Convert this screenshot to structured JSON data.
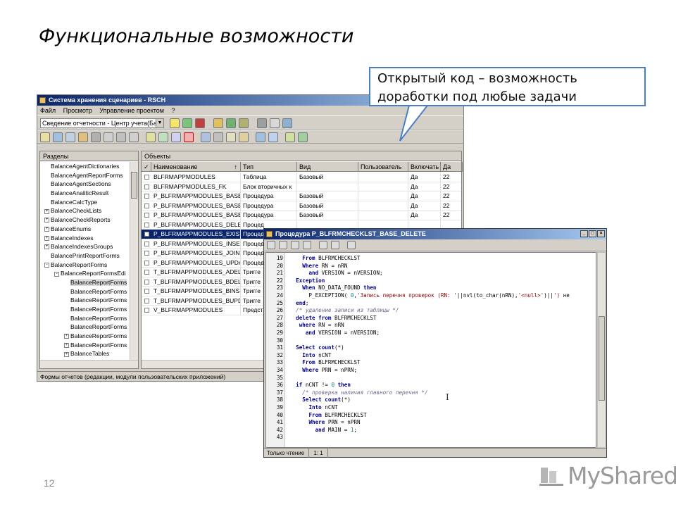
{
  "slide": {
    "title": "Функциональные возможности",
    "page_number": "12",
    "logo_text": "MyShared"
  },
  "callout": {
    "line1": "Открытый код – возможность",
    "line2": "доработки под любые задачи"
  },
  "main_window": {
    "title": "Система хранения сценариев - RSCH",
    "menu": [
      "Файл",
      "Просмотр",
      "Управление проектом",
      "?"
    ],
    "combo_value": "Сведение отчетности - Центр учета(Ба",
    "left_pane_title": "Разделы",
    "right_pane_title": "Объекты",
    "tree": [
      {
        "label": "BalanceAgentDictionaries",
        "indent": 0,
        "toggle": ""
      },
      {
        "label": "BalanceAgentReportForms",
        "indent": 0,
        "toggle": ""
      },
      {
        "label": "BalanceAgentSections",
        "indent": 0,
        "toggle": ""
      },
      {
        "label": "BalanceAnaliticResult",
        "indent": 0,
        "toggle": ""
      },
      {
        "label": "BalanceCalcType",
        "indent": 0,
        "toggle": ""
      },
      {
        "label": "BalanceCheckLists",
        "indent": 0,
        "toggle": "+"
      },
      {
        "label": "BalanceCheckReports",
        "indent": 0,
        "toggle": "+"
      },
      {
        "label": "BalanceEnums",
        "indent": 0,
        "toggle": "+"
      },
      {
        "label": "BalanceIndexes",
        "indent": 0,
        "toggle": "+"
      },
      {
        "label": "BalanceIndexesGroups",
        "indent": 0,
        "toggle": "+"
      },
      {
        "label": "BalancePrintReportForms",
        "indent": 0,
        "toggle": ""
      },
      {
        "label": "BalanceReportForms",
        "indent": 0,
        "toggle": "-"
      },
      {
        "label": "BalanceReportFormsEdi",
        "indent": 1,
        "toggle": "-"
      },
      {
        "label": "BalanceReportForms",
        "indent": 2,
        "toggle": "",
        "selected": true
      },
      {
        "label": "BalanceReportForms",
        "indent": 2,
        "toggle": ""
      },
      {
        "label": "BalanceReportForms",
        "indent": 2,
        "toggle": ""
      },
      {
        "label": "BalanceReportForms",
        "indent": 2,
        "toggle": ""
      },
      {
        "label": "BalanceReportForms",
        "indent": 2,
        "toggle": ""
      },
      {
        "label": "BalanceReportForms",
        "indent": 2,
        "toggle": ""
      },
      {
        "label": "BalanceReportForms",
        "indent": 2,
        "toggle": "+"
      },
      {
        "label": "BalanceReportForms",
        "indent": 2,
        "toggle": "+"
      },
      {
        "label": "BalanceTables",
        "indent": 2,
        "toggle": "+"
      },
      {
        "label": "BalanceReportViewPeriods",
        "indent": 0,
        "toggle": "+"
      }
    ],
    "columns": [
      "Наименование",
      "Тип",
      "Вид",
      "Пользователь",
      "Включать",
      "Да"
    ],
    "rows": [
      {
        "name": "BLFRMAPPMODULES",
        "type": "Таблица",
        "kind": "Базовый",
        "user": "",
        "incl": "Да",
        "date": "22"
      },
      {
        "name": "BLFRMAPPMODULES_FK",
        "type": "Блок вторичных к",
        "kind": "",
        "user": "",
        "incl": "Да",
        "date": "22"
      },
      {
        "name": "P_BLFRMAPPMODULES_BASE_DI",
        "type": "Процедура",
        "kind": "Базовый",
        "user": "",
        "incl": "Да",
        "date": "22"
      },
      {
        "name": "P_BLFRMAPPMODULES_BASE_IN",
        "type": "Процедура",
        "kind": "Базовый",
        "user": "",
        "incl": "Да",
        "date": "22"
      },
      {
        "name": "P_BLFRMAPPMODULES_BASE_UI",
        "type": "Процедура",
        "kind": "Базовый",
        "user": "",
        "incl": "Да",
        "date": "22"
      },
      {
        "name": "P_BLFRMAPPMODULES_DELETE",
        "type": "Процед",
        "kind": "",
        "user": "",
        "incl": "",
        "date": ""
      },
      {
        "name": "P_BLFRMAPPMODULES_EXISTS",
        "type": "Процед",
        "kind": "",
        "user": "",
        "incl": "",
        "date": "",
        "selected": true
      },
      {
        "name": "P_BLFRMAPPMODULES_INSERT",
        "type": "Процед",
        "kind": "",
        "user": "",
        "incl": "",
        "date": ""
      },
      {
        "name": "P_BLFRMAPPMODULES_JOINS",
        "type": "Процед",
        "kind": "",
        "user": "",
        "incl": "",
        "date": ""
      },
      {
        "name": "P_BLFRMAPPMODULES_UPDATE",
        "type": "Процед",
        "kind": "",
        "user": "",
        "incl": "",
        "date": ""
      },
      {
        "name": "T_BLFRMAPPMODULES_ADELETE",
        "type": "Тригге",
        "kind": "",
        "user": "",
        "incl": "",
        "date": ""
      },
      {
        "name": "T_BLFRMAPPMODULES_BDELETE",
        "type": "Тригге",
        "kind": "",
        "user": "",
        "incl": "",
        "date": ""
      },
      {
        "name": "T_BLFRMAPPMODULES_BINSERT",
        "type": "Тригге",
        "kind": "",
        "user": "",
        "incl": "",
        "date": ""
      },
      {
        "name": "T_BLFRMAPPMODULES_BUPDAT",
        "type": "Тригге",
        "kind": "",
        "user": "",
        "incl": "",
        "date": ""
      },
      {
        "name": "V_BLFRMAPPMODULES",
        "type": "Предст",
        "kind": "",
        "user": "",
        "incl": "",
        "date": ""
      }
    ],
    "status": "Формы отчетов (редакции, модули пользовательских приложений)"
  },
  "editor_window": {
    "title": "Процедура P_BLFRMCHECKLST_BASE_DELETE",
    "lines": [
      {
        "n": "19",
        "t": [
          [
            "",
            "    "
          ],
          [
            "kw",
            "From"
          ],
          [
            "",
            " BLFRMCHECKLST"
          ]
        ]
      },
      {
        "n": "20",
        "t": [
          [
            "",
            "    "
          ],
          [
            "kw",
            "Where"
          ],
          [
            "",
            " RN = nRN"
          ]
        ]
      },
      {
        "n": "21",
        "t": [
          [
            "",
            "      "
          ],
          [
            "kw",
            "and"
          ],
          [
            "",
            " VERSION = nVERSION;"
          ]
        ]
      },
      {
        "n": "22",
        "t": [
          [
            "",
            "  "
          ],
          [
            "kw",
            "Exception"
          ]
        ]
      },
      {
        "n": "23",
        "t": [
          [
            "",
            "    "
          ],
          [
            "kw",
            "When"
          ],
          [
            "",
            " NO_DATA_FOUND "
          ],
          [
            "kw",
            "then"
          ]
        ]
      },
      {
        "n": "24",
        "t": [
          [
            "",
            "      P_EXCEPTION( "
          ],
          [
            "num",
            "0"
          ],
          [
            "",
            ","
          ],
          [
            "st",
            "'Запись перечня проверок (RN: '"
          ],
          [
            "",
            "||nvl(to_char(nRN),"
          ],
          [
            "st",
            "'<null>'"
          ],
          [
            "",
            ")||"
          ],
          [
            "st",
            "')"
          ],
          [
            "",
            " не"
          ]
        ]
      },
      {
        "n": "25",
        "t": [
          [
            "",
            "  "
          ],
          [
            "kw",
            "end"
          ],
          [
            "",
            ";"
          ]
        ]
      },
      {
        "n": "26",
        "t": [
          [
            "cm",
            "  /* удаление записи из таблицы */"
          ]
        ]
      },
      {
        "n": "27",
        "t": [
          [
            "",
            "  "
          ],
          [
            "kw",
            "delete from"
          ],
          [
            "",
            " BLFRMCHECKLST"
          ]
        ]
      },
      {
        "n": "28",
        "t": [
          [
            "",
            "   "
          ],
          [
            "kw",
            "where"
          ],
          [
            "",
            " RN = nRN"
          ]
        ]
      },
      {
        "n": "29",
        "t": [
          [
            "",
            "     "
          ],
          [
            "kw",
            "and"
          ],
          [
            "",
            " VERSION = nVERSION;"
          ]
        ]
      },
      {
        "n": "30",
        "t": [
          [
            "",
            ""
          ]
        ]
      },
      {
        "n": "31",
        "t": [
          [
            "",
            "  "
          ],
          [
            "kw",
            "Select count"
          ],
          [
            "",
            "(*)"
          ]
        ]
      },
      {
        "n": "32",
        "t": [
          [
            "",
            "    "
          ],
          [
            "kw",
            "Into"
          ],
          [
            "",
            " nCNT"
          ]
        ]
      },
      {
        "n": "33",
        "t": [
          [
            "",
            "    "
          ],
          [
            "kw",
            "From"
          ],
          [
            "",
            " BLFRMCHECKLST"
          ]
        ]
      },
      {
        "n": "34",
        "t": [
          [
            "",
            "    "
          ],
          [
            "kw",
            "Where"
          ],
          [
            "",
            " PRN = nPRN;"
          ]
        ]
      },
      {
        "n": "35",
        "t": [
          [
            "",
            ""
          ]
        ]
      },
      {
        "n": "36",
        "t": [
          [
            "",
            "  "
          ],
          [
            "kw",
            "if"
          ],
          [
            "",
            " nCNT != "
          ],
          [
            "num",
            "0"
          ],
          [
            "",
            " "
          ],
          [
            "kw",
            "then"
          ]
        ]
      },
      {
        "n": "37",
        "t": [
          [
            "cm",
            "    /* проверка наличия главного перечня */"
          ]
        ]
      },
      {
        "n": "38",
        "t": [
          [
            "",
            "    "
          ],
          [
            "kw",
            "Select count"
          ],
          [
            "",
            "(*)"
          ]
        ]
      },
      {
        "n": "39",
        "t": [
          [
            "",
            "      "
          ],
          [
            "kw",
            "Into"
          ],
          [
            "",
            " nCNT"
          ]
        ]
      },
      {
        "n": "40",
        "t": [
          [
            "",
            "      "
          ],
          [
            "kw",
            "From"
          ],
          [
            "",
            " BLFRMCHECKLST"
          ]
        ]
      },
      {
        "n": "41",
        "t": [
          [
            "",
            "      "
          ],
          [
            "kw",
            "Where"
          ],
          [
            "",
            " PRN = nPRN"
          ]
        ]
      },
      {
        "n": "42",
        "t": [
          [
            "",
            "        "
          ],
          [
            "kw",
            "and"
          ],
          [
            "",
            " MAIN = "
          ],
          [
            "num",
            "1"
          ],
          [
            "",
            ";"
          ]
        ]
      },
      {
        "n": "43",
        "t": [
          [
            "",
            ""
          ]
        ]
      }
    ],
    "status_mode": "Только чтение",
    "status_pos": "1: 1"
  }
}
